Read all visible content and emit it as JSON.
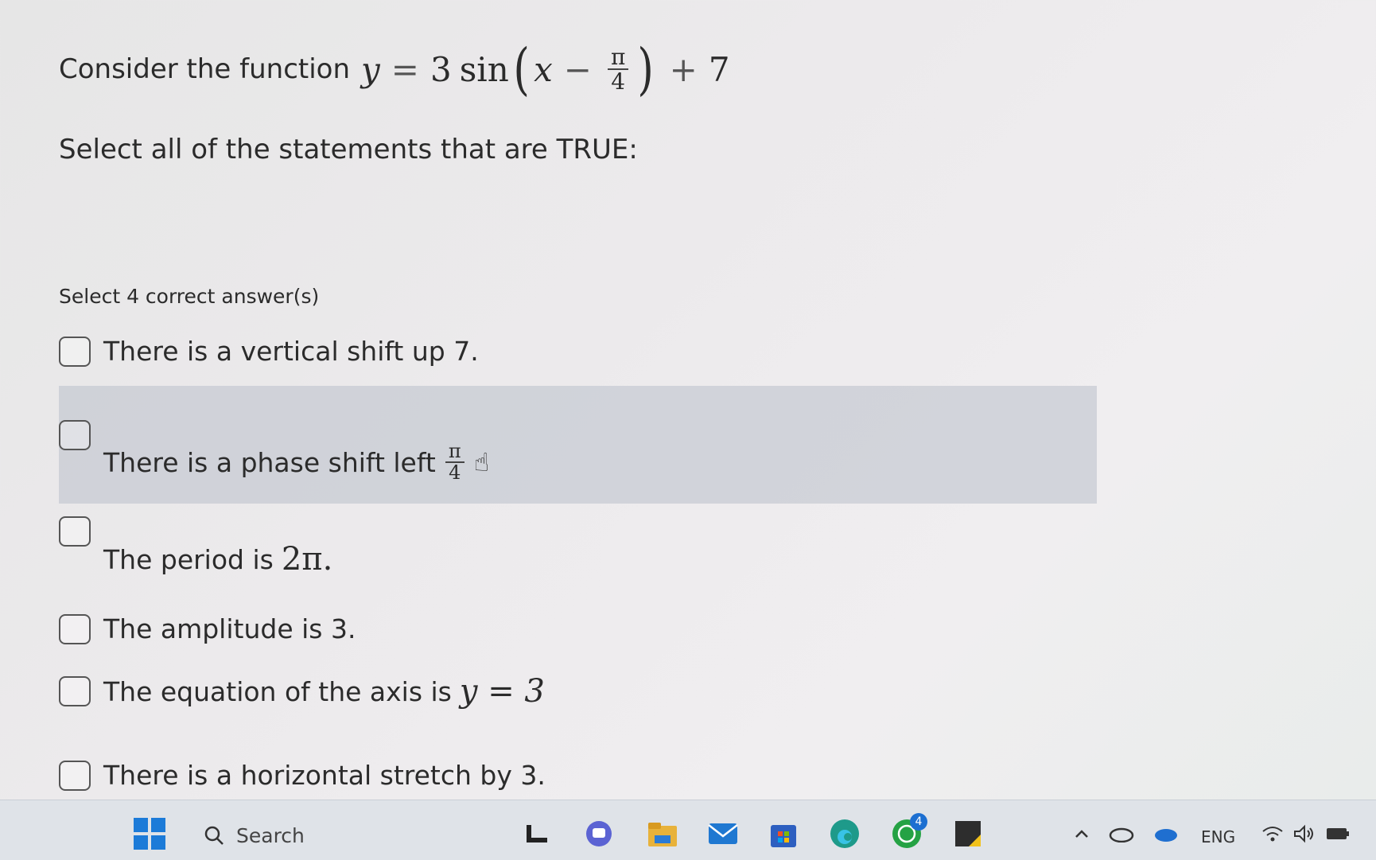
{
  "question": {
    "intro": "Consider the function",
    "formula": {
      "y": "y",
      "equals": "=",
      "coef": "3",
      "func": "sin",
      "x": "x",
      "minus": "−",
      "frac_num": "π",
      "frac_den": "4",
      "plus": "+",
      "const": "7"
    },
    "instruction": "Select all of the statements that are TRUE:",
    "hint": "Select 4 correct answer(s)"
  },
  "options": [
    {
      "text": "There is a vertical shift up 7.",
      "checked": false
    },
    {
      "text": "There is a phase shift left",
      "frac_num": "π",
      "frac_den": "4",
      "checked": false
    },
    {
      "text": "The period is",
      "math": "2π.",
      "checked": false
    },
    {
      "text": "The amplitude is 3.",
      "checked": false
    },
    {
      "text": "The equation of the axis is",
      "math": "y = 3",
      "checked": false
    },
    {
      "text": "There is a horizontal stretch by 3.",
      "checked": false
    }
  ],
  "taskbar": {
    "search_label": "Search",
    "language": "ENG",
    "notification_count": "4",
    "icons": [
      "windows-start-icon",
      "search-icon",
      "task-view-icon",
      "chat-icon",
      "file-explorer-icon",
      "mail-icon",
      "store-icon",
      "edge-icon",
      "whatsapp-icon",
      "sticky-notes-icon",
      "tray-chevron-icon",
      "onedrive-icon",
      "cloud-icon",
      "wifi-icon",
      "volume-icon",
      "battery-icon"
    ]
  }
}
